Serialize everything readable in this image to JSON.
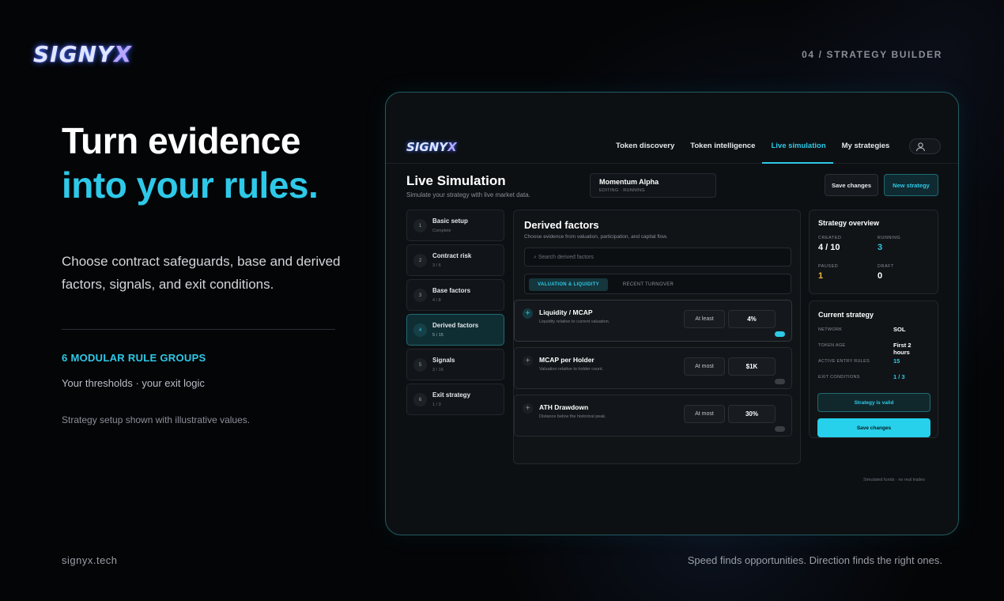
{
  "brand": {
    "logo_main": "SIGNY",
    "logo_x": "X"
  },
  "page_tag": "04 / STRATEGY BUILDER",
  "hero": {
    "line1": "Turn evidence",
    "line2": "into your rules.",
    "description": "Choose contract safeguards, base and derived factors, signals, and exit conditions."
  },
  "rule_groups": {
    "title": "6 MODULAR RULE GROUPS",
    "subtitle": "Your thresholds · your exit logic"
  },
  "note": "Strategy setup shown with illustrative values.",
  "footer": {
    "site": "signyx.tech",
    "tagline": "Speed finds opportunities. Direction finds the right ones."
  },
  "app": {
    "logo_main": "SIGNY",
    "logo_x": "X",
    "nav": [
      {
        "label": "Token discovery"
      },
      {
        "label": "Token intelligence"
      },
      {
        "label": "Live simulation"
      },
      {
        "label": "My strategies"
      }
    ],
    "title": "Live Simulation",
    "subtitle": "Simulate your strategy with live market data.",
    "strategy": {
      "name": "Momentum Alpha",
      "status": "EDITING · RUNNING"
    },
    "save_label": "Save changes",
    "new_label": "New strategy",
    "steps": [
      {
        "num": "1",
        "title": "Basic setup",
        "progress": "Complete"
      },
      {
        "num": "2",
        "title": "Contract risk",
        "progress": "3 / 6"
      },
      {
        "num": "3",
        "title": "Base factors",
        "progress": "4 / 8"
      },
      {
        "num": "4",
        "title": "Derived factors",
        "progress": "5 / 15"
      },
      {
        "num": "5",
        "title": "Signals",
        "progress": "3 / 16"
      },
      {
        "num": "6",
        "title": "Exit strategy",
        "progress": "1 / 3"
      }
    ],
    "derived": {
      "title": "Derived factors",
      "subtitle": "Choose evidence from valuation, participation, and capital flow.",
      "search_placeholder": "⌕ Search derived factors",
      "tab_active": "VALUATION & LIQUIDITY",
      "tab_other": "RECENT TURNOVER",
      "factors": [
        {
          "name": "Liquidity / MCAP",
          "desc": "Liquidity relative to current valuation.",
          "op": "At least",
          "value": "4%"
        },
        {
          "name": "MCAP per Holder",
          "desc": "Valuation relative to holder count.",
          "op": "At most",
          "value": "$1K"
        },
        {
          "name": "ATH Drawdown",
          "desc": "Distance below the historical peak.",
          "op": "At most",
          "value": "30%"
        }
      ]
    },
    "overview": {
      "title": "Strategy overview",
      "created_label": "CREATED",
      "created": "4 / 10",
      "running_label": "RUNNING",
      "running": "3",
      "paused_label": "PAUSED",
      "paused": "1",
      "draft_label": "DRAFT",
      "draft": "0"
    },
    "current": {
      "title": "Current strategy",
      "network_label": "NETWORK",
      "network": "SOL",
      "age_label": "TOKEN AGE",
      "age": "First 2 hours",
      "entry_label": "ACTIVE ENTRY RULES",
      "entry": "15",
      "exit_label": "EXIT CONDITIONS",
      "exit": "1 / 3",
      "valid": "Strategy is valid",
      "save": "Save changes"
    },
    "disclaimer": "Simulated funds · no real trades"
  },
  "colors": {
    "accent": "#2ec9e8",
    "paused": "#f0b43c",
    "border": "#1f5d63"
  }
}
